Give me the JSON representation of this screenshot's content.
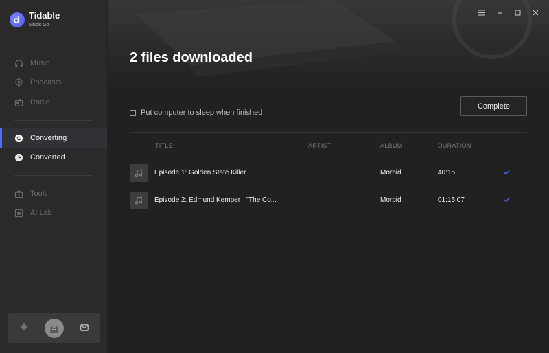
{
  "app": {
    "name": "Tidable",
    "subtitle": "Music Go"
  },
  "sidebar": {
    "items": [
      {
        "id": "music",
        "label": "Music",
        "icon": "headphones-icon"
      },
      {
        "id": "podcasts",
        "label": "Podcasts",
        "icon": "podcast-icon"
      },
      {
        "id": "radio",
        "label": "Radio",
        "icon": "radio-icon"
      },
      {
        "id": "converting",
        "label": "Converting",
        "icon": "converting-icon",
        "active": true
      },
      {
        "id": "converted",
        "label": "Converted",
        "icon": "clock-icon"
      },
      {
        "id": "tools",
        "label": "Tools",
        "icon": "toolbox-icon"
      },
      {
        "id": "ai-lab",
        "label": "AI Lab",
        "icon": "ai-icon"
      }
    ],
    "bottom_icons": [
      "gear-icon",
      "avatar",
      "mail-icon"
    ]
  },
  "window_controls": [
    "menu-icon",
    "minimize-icon",
    "maximize-icon",
    "close-icon"
  ],
  "main": {
    "title": "2 files downloaded",
    "sleep_option": "Put computer to sleep when finished",
    "sleep_checked": false,
    "complete_button": "Complete",
    "columns": {
      "title": "TITLE",
      "artist": "ARTIST",
      "album": "ALBUM",
      "duration": "DURATION"
    },
    "rows": [
      {
        "title": "Episode 1: Golden State Killer",
        "artist": "",
        "album": "Morbid",
        "duration": "40:15",
        "done": true
      },
      {
        "title": "Episode 2: Edmund Kemper   \"The Co...",
        "artist": "",
        "album": "Morbid",
        "duration": "01:15:07",
        "done": true
      }
    ]
  },
  "colors": {
    "accent": "#4c6ef5",
    "sidebar_bg": "#2a2a2a",
    "main_bg": "#212121"
  }
}
